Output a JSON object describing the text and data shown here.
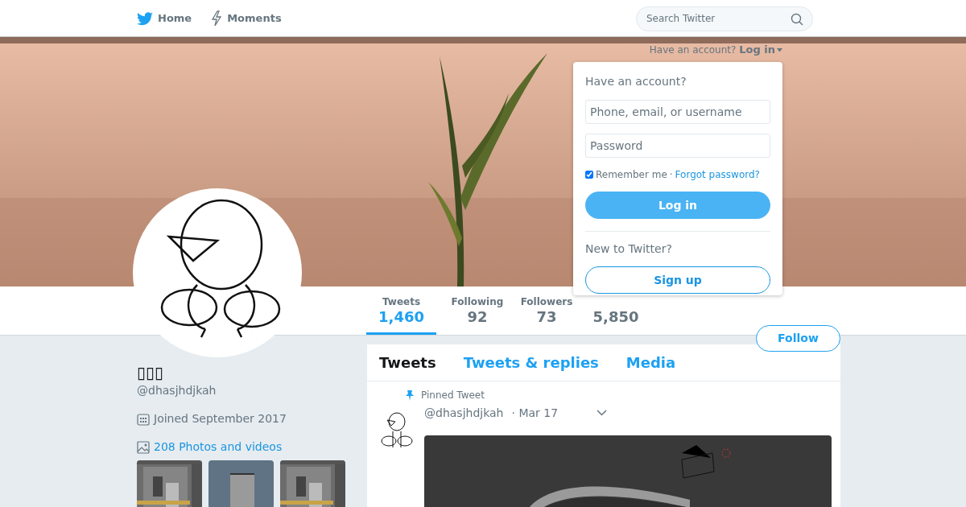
{
  "nav": {
    "items": [
      {
        "label": "Home"
      },
      {
        "label": "Moments"
      }
    ],
    "search": {
      "placeholder": "Search Twitter"
    }
  },
  "login_prompt": {
    "text": "Have an account?",
    "link": "Log in"
  },
  "login_dropdown": {
    "title": "Have an account?",
    "username": {
      "placeholder": "Phone, email, or username"
    },
    "password": {
      "placeholder": "Password"
    },
    "remember": {
      "label": "Remember me",
      "checked": true
    },
    "separator": "·",
    "forgot": "Forgot password?",
    "login_button": "Log in",
    "signup_prompt": "New to Twitter?",
    "signup_button": "Sign up"
  },
  "stats": [
    {
      "label": "Tweets",
      "value": "1,460",
      "selected": true
    },
    {
      "label": "Following",
      "value": "92",
      "selected": false
    },
    {
      "label": "Followers",
      "value": "73",
      "selected": false
    },
    {
      "value": "5,850",
      "selected": false
    }
  ],
  "follow_button": "Follow",
  "profile": {
    "name": "▯▯▯",
    "handle": "@dhasjhdjkah",
    "joined": "Joined September 2017",
    "photos_link": "208 Photos and videos"
  },
  "timeline_tabs": [
    {
      "label": "Tweets",
      "selected": true
    },
    {
      "label": "Tweets & replies",
      "selected": false
    },
    {
      "label": "Media",
      "selected": false
    }
  ],
  "tweets": [
    {
      "pinned": true,
      "pinned_label": "Pinned Tweet",
      "handle": "@dhasjhdjkah",
      "date": "· Mar 17"
    }
  ]
}
